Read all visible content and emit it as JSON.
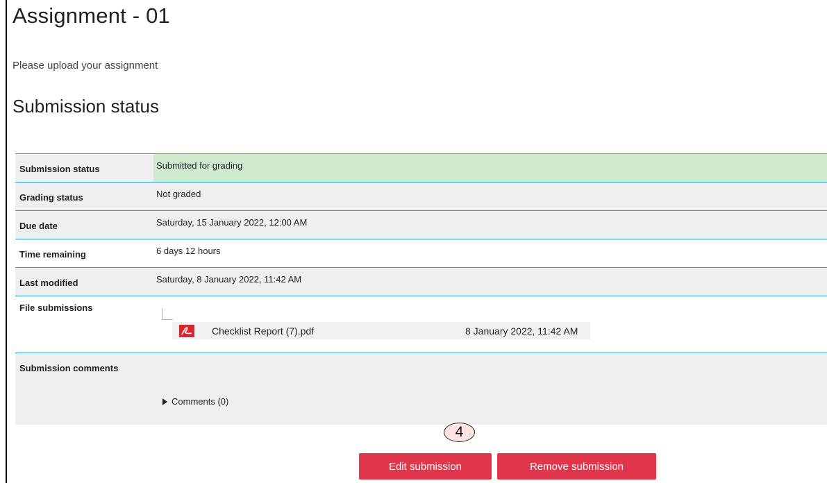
{
  "page": {
    "title": "Assignment - 01",
    "intro": "Please upload your assignment",
    "section_title": "Submission status"
  },
  "status_rows": [
    {
      "label": "Submission status",
      "value": "Submitted for grading"
    },
    {
      "label": "Grading status",
      "value": "Not graded"
    },
    {
      "label": "Due date",
      "value": "Saturday, 15 January 2022, 12:00 AM"
    },
    {
      "label": "Time remaining",
      "value": "6 days 12 hours"
    },
    {
      "label": "Last modified",
      "value": "Saturday, 8 January 2022, 11:42 AM"
    },
    {
      "label": "File submissions"
    },
    {
      "label": "Submission comments"
    }
  ],
  "file": {
    "name": "Checklist Report (7).pdf",
    "date": "8 January 2022, 11:42 AM",
    "icon": "pdf-icon"
  },
  "comments": {
    "toggle_label": "Comments (0)"
  },
  "step_marker": "4",
  "buttons": {
    "edit": "Edit submission",
    "remove": "Remove submission"
  },
  "colors": {
    "accent_border": "#2ea0d8",
    "success_bg": "#cfeacf",
    "button_bg": "#e0354a"
  }
}
